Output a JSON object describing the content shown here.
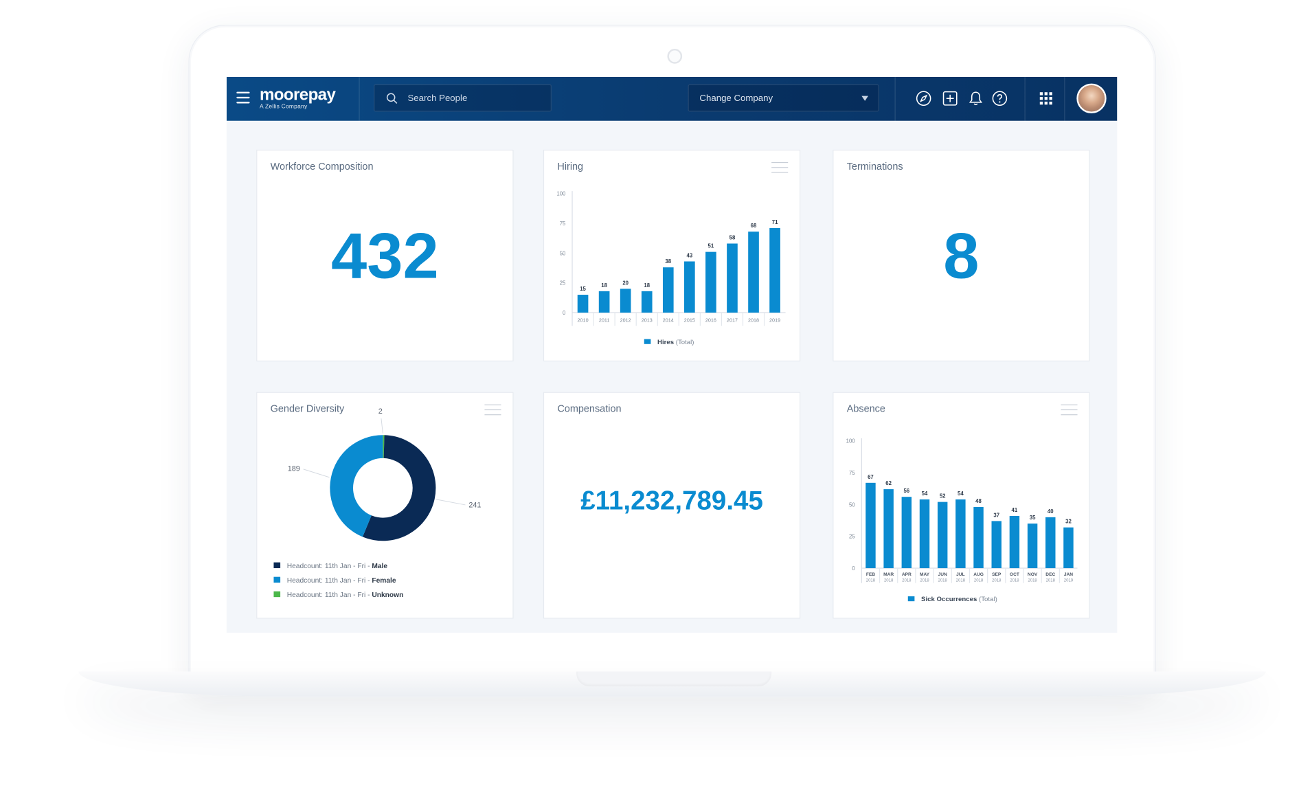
{
  "header": {
    "logo_main": "moorepay",
    "logo_sub": "A Zellis Company",
    "search_placeholder": "Search People",
    "company_label": "Change Company",
    "icons": [
      "compass-icon",
      "add-icon",
      "bell-icon",
      "help-icon",
      "apps-grid-icon"
    ]
  },
  "workforce": {
    "title": "Workforce Composition",
    "value": "432"
  },
  "terminations": {
    "title": "Terminations",
    "value": "8"
  },
  "compensation": {
    "title": "Compensation",
    "value": "£11,232,789.45"
  },
  "hiring": {
    "title": "Hiring"
  },
  "gender": {
    "title": "Gender Diversity"
  },
  "absence": {
    "title": "Absence"
  },
  "colors": {
    "accent": "#0a8bd0",
    "navy": "#0a2a55",
    "green": "#4cb84a",
    "header": "#0a3b70"
  },
  "chart_data": [
    {
      "type": "bar",
      "title": "Hiring",
      "categories": [
        "2010",
        "2011",
        "2012",
        "2013",
        "2014",
        "2015",
        "2016",
        "2017",
        "2018",
        "2019"
      ],
      "series": [
        {
          "name": "Hires",
          "values": [
            15,
            18,
            20,
            18,
            38,
            43,
            51,
            58,
            68,
            71
          ]
        }
      ],
      "legend": {
        "name": "Hires",
        "suffix": "(Total)"
      },
      "yticks": [
        "0",
        "25",
        "50",
        "75",
        "100"
      ],
      "ylim": [
        0,
        100
      ]
    },
    {
      "type": "pie",
      "title": "Gender Diversity",
      "slices": [
        {
          "label": "Male",
          "value": 241,
          "color": "#0a2a55"
        },
        {
          "label": "Female",
          "value": 189,
          "color": "#0a8bd0"
        },
        {
          "label": "Unknown",
          "value": 2,
          "color": "#4cb84a"
        }
      ],
      "legend_prefix": "Headcount: 11th Jan - Fri - "
    },
    {
      "type": "bar",
      "title": "Absence",
      "categories": [
        [
          "FEB",
          "2018"
        ],
        [
          "MAR",
          "2018"
        ],
        [
          "APR",
          "2018"
        ],
        [
          "MAY",
          "2018"
        ],
        [
          "JUN",
          "2018"
        ],
        [
          "JUL",
          "2018"
        ],
        [
          "AUG",
          "2018"
        ],
        [
          "SEP",
          "2018"
        ],
        [
          "OCT",
          "2018"
        ],
        [
          "NOV",
          "2018"
        ],
        [
          "DEC",
          "2018"
        ],
        [
          "JAN",
          "2019"
        ]
      ],
      "series": [
        {
          "name": "Sick Occurrences",
          "values": [
            67,
            62,
            56,
            54,
            52,
            54,
            48,
            37,
            41,
            35,
            40,
            32
          ]
        }
      ],
      "legend": {
        "name": "Sick Occurrences",
        "suffix": "(Total)"
      },
      "yticks": [
        "0",
        "25",
        "50",
        "75",
        "100"
      ],
      "ylim": [
        0,
        100
      ]
    }
  ]
}
